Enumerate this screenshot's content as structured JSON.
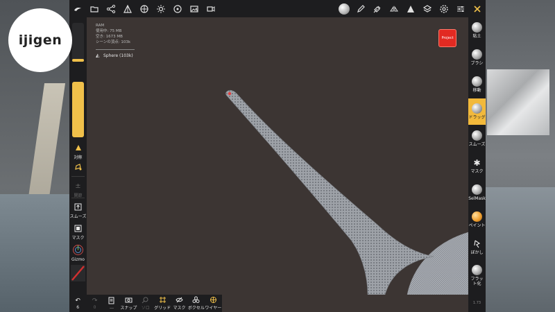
{
  "overlay_logo": {
    "text": "ijigen"
  },
  "topbar": {
    "icons": [
      "logo-icon",
      "folder-icon",
      "scene-graph-icon",
      "tools-icon",
      "grid-sphere-icon",
      "sun-icon",
      "material-icon",
      "image-icon",
      "video-icon",
      "stroke-ball-icon",
      "pen-icon",
      "picker-icon",
      "symmetry-icon",
      "topology-icon",
      "layers-icon",
      "settings-icon",
      "sliders-icon",
      "tools-cross-icon"
    ]
  },
  "stats": {
    "line1": "RAM",
    "line2": "使用中: 75 MB",
    "line3": "空き: 1673 MB",
    "line4": "シーンの頂点: 103k"
  },
  "scene": {
    "object_label": "Sphere (103k)"
  },
  "project_button": {
    "label": "Project"
  },
  "left_toolbar": {
    "size_level": 0.08,
    "intensity_level": 0.3,
    "symmetry_label": "対称",
    "items": [
      {
        "label": "",
        "icon": "lasso-icon"
      },
      {
        "label": "関節",
        "icon": "pin-icon"
      },
      {
        "label": "スムーズ",
        "icon": "smooth-box-icon"
      },
      {
        "label": "マスク",
        "icon": "mask-box-icon"
      },
      {
        "label": "Gizmo",
        "icon": "gizmo-icon"
      }
    ]
  },
  "right_toolbar": {
    "active_tool": "ドラッグ",
    "tools": [
      {
        "label": "粘土",
        "icon": "clay-ball-icon"
      },
      {
        "label": "ブラシ",
        "icon": "brush-ball-icon"
      },
      {
        "label": "移動",
        "icon": "move-ball-icon"
      },
      {
        "label": "ドラッグ",
        "icon": "drag-ball-icon"
      },
      {
        "label": "スムーズ",
        "icon": "smooth-ball-icon"
      },
      {
        "label": "マスク",
        "icon": "mask-star-icon"
      },
      {
        "label": "SelMask",
        "icon": "selmask-ball-icon"
      },
      {
        "label": "ペイント",
        "icon": "paint-ball-icon"
      },
      {
        "label": "ぼかし",
        "icon": "blur-icon"
      },
      {
        "label": "フラット化",
        "icon": "flatten-ball-icon"
      }
    ],
    "version": "1.73"
  },
  "bottom_toolbar": {
    "items": [
      {
        "label": "6",
        "icon": "undo-icon"
      },
      {
        "label": "0",
        "icon": "redo-icon"
      },
      {
        "label": "…",
        "icon": "history-icon"
      },
      {
        "label": "スナップ",
        "icon": "camera-icon"
      },
      {
        "label": "ソロ",
        "icon": "search-icon"
      },
      {
        "label": "グリッド",
        "icon": "grid-icon"
      },
      {
        "label": "マスク",
        "icon": "eye-slash-icon"
      },
      {
        "label": "ボクセル",
        "icon": "voxel-icon"
      },
      {
        "label": "ワイヤー",
        "icon": "wire-icon"
      }
    ]
  },
  "colors": {
    "accent": "#f0c04a",
    "background": "#3c3533",
    "toolbar": "#1d1d1f",
    "project": "#e22a22",
    "mesh": "#a8abb0"
  }
}
